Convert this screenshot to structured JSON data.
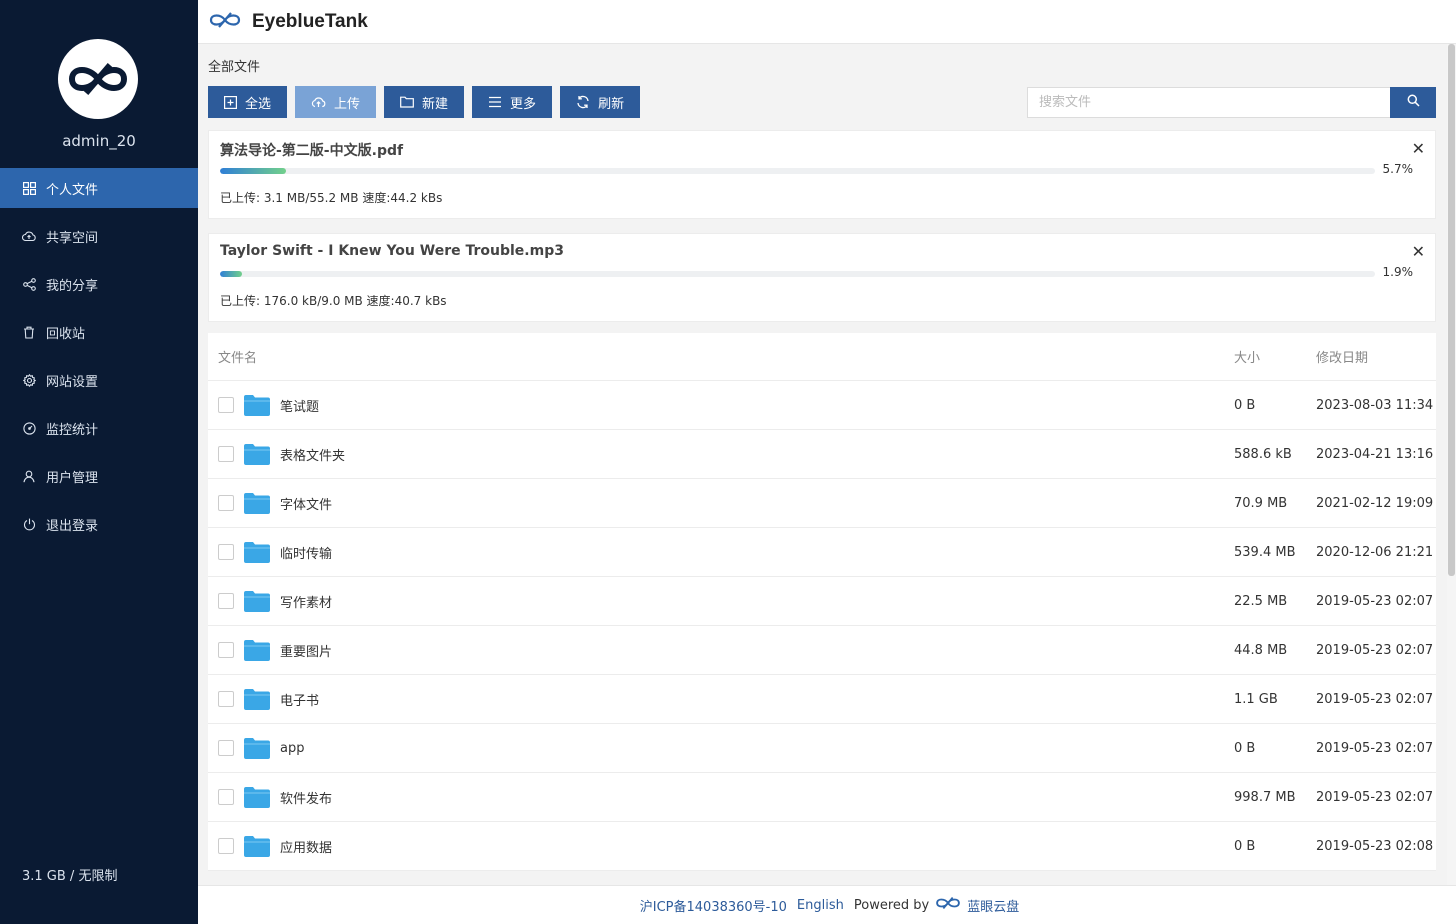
{
  "app": {
    "brand": "EyeblueTank"
  },
  "sidebar": {
    "username": "admin_20",
    "items": [
      {
        "label": "个人文件",
        "icon": "grid-icon",
        "active": true
      },
      {
        "label": "共享空间",
        "icon": "cloud-icon",
        "active": false
      },
      {
        "label": "我的分享",
        "icon": "share-icon",
        "active": false
      },
      {
        "label": "回收站",
        "icon": "trash-icon",
        "active": false
      },
      {
        "label": "网站设置",
        "icon": "gear-icon",
        "active": false
      },
      {
        "label": "监控统计",
        "icon": "dashboard-icon",
        "active": false
      },
      {
        "label": "用户管理",
        "icon": "user-icon",
        "active": false
      },
      {
        "label": "退出登录",
        "icon": "power-icon",
        "active": false
      }
    ],
    "storage": "3.1 GB / 无限制"
  },
  "main": {
    "breadcrumb": "全部文件",
    "toolbar": {
      "select_all": "全选",
      "upload": "上传",
      "new": "新建",
      "more": "更多",
      "refresh": "刷新"
    },
    "search": {
      "placeholder": "搜索文件",
      "value": ""
    },
    "uploads": [
      {
        "name": "算法导论-第二版-中文版.pdf",
        "percent_label": "5.7%",
        "progress": 0.057,
        "status": "已上传: 3.1 MB/55.2 MB 速度:44.2 kBs"
      },
      {
        "name": "Taylor Swift - I Knew You Were Trouble.mp3",
        "percent_label": "1.9%",
        "progress": 0.019,
        "status": "已上传: 176.0 kB/9.0 MB 速度:40.7 kBs"
      }
    ],
    "table": {
      "headers": {
        "name": "文件名",
        "size": "大小",
        "date": "修改日期"
      },
      "rows": [
        {
          "name": "笔试题",
          "size": "0 B",
          "date": "2023-08-03 11:34"
        },
        {
          "name": "表格文件夹",
          "size": "588.6 kB",
          "date": "2023-04-21 13:16"
        },
        {
          "name": "字体文件",
          "size": "70.9 MB",
          "date": "2021-02-12 19:09"
        },
        {
          "name": "临时传输",
          "size": "539.4 MB",
          "date": "2020-12-06 21:21"
        },
        {
          "name": "写作素材",
          "size": "22.5 MB",
          "date": "2019-05-23 02:07"
        },
        {
          "name": "重要图片",
          "size": "44.8 MB",
          "date": "2019-05-23 02:07"
        },
        {
          "name": "电子书",
          "size": "1.1 GB",
          "date": "2019-05-23 02:07"
        },
        {
          "name": "app",
          "size": "0 B",
          "date": "2019-05-23 02:07"
        },
        {
          "name": "软件发布",
          "size": "998.7 MB",
          "date": "2019-05-23 02:07"
        },
        {
          "name": "应用数据",
          "size": "0 B",
          "date": "2019-05-23 02:08"
        }
      ]
    }
  },
  "footer": {
    "icp": "沪ICP备14038360号-10",
    "lang": "English",
    "powered_by": "Powered by",
    "product": "蓝眼云盘"
  },
  "colors": {
    "sidebar_bg": "#0a1a33",
    "accent": "#2d5b9a",
    "active_item": "#2d66ad",
    "folder": "#3aa7e6"
  }
}
